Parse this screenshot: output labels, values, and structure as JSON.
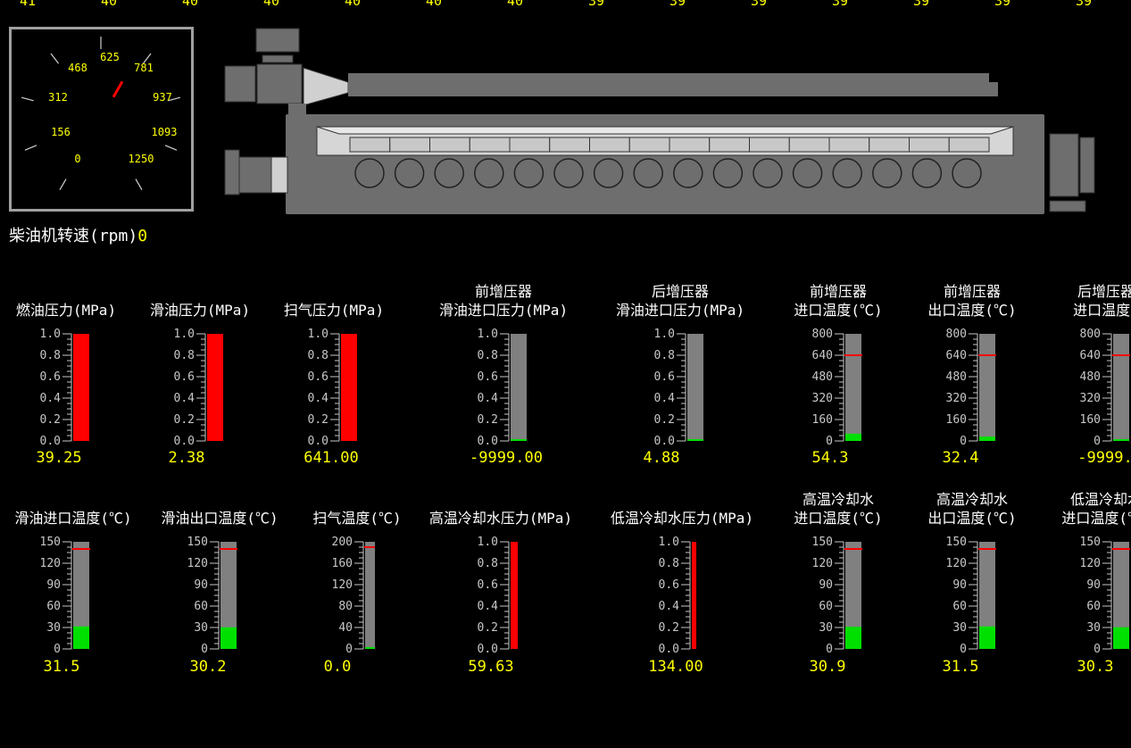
{
  "top_numbers": [
    "41",
    "40",
    "40",
    "40",
    "40",
    "40",
    "40",
    "39",
    "39",
    "39",
    "39",
    "39",
    "39",
    "39"
  ],
  "colors": {
    "background": "#000000",
    "text": "#ffff00",
    "bar_red": "#ff0000",
    "bar_green": "#00e000",
    "bar_bg": "#808080",
    "limit": "#ff0000"
  },
  "engine": {
    "rpm_label": "柴油机转速(rpm)",
    "rpm_value": "0",
    "dial_labels": [
      "0",
      "156",
      "312",
      "468",
      "625",
      "781",
      "937",
      "1093",
      "1250"
    ],
    "cylinders": 16
  },
  "gauges_row1": [
    {
      "title": [
        "燃油压力(MPa)"
      ],
      "ticks": [
        "1.0",
        "0.8",
        "0.6",
        "0.4",
        "0.2",
        "0.0"
      ],
      "max": 1.0,
      "fill": 1.0,
      "color": "red",
      "limit": null,
      "value": "39.25"
    },
    {
      "title": [
        "滑油压力(MPa)"
      ],
      "ticks": [
        "1.0",
        "0.8",
        "0.6",
        "0.4",
        "0.2",
        "0.0"
      ],
      "max": 1.0,
      "fill": 1.0,
      "color": "red",
      "limit": null,
      "value": "2.38"
    },
    {
      "title": [
        "扫气压力(MPa)"
      ],
      "ticks": [
        "1.0",
        "0.8",
        "0.6",
        "0.4",
        "0.2",
        "0.0"
      ],
      "max": 1.0,
      "fill": 1.0,
      "color": "red",
      "limit": null,
      "value": "641.00"
    },
    {
      "title": [
        "前增压器",
        "滑油进口压力(MPa)"
      ],
      "ticks": [
        "1.0",
        "0.8",
        "0.6",
        "0.4",
        "0.2",
        "0.0"
      ],
      "max": 1.0,
      "fill": 0.0,
      "color": "green",
      "limit": null,
      "value": "-9999.00"
    },
    {
      "title": [
        "后增压器",
        "滑油进口压力(MPa)"
      ],
      "ticks": [
        "1.0",
        "0.8",
        "0.6",
        "0.4",
        "0.2",
        "0.0"
      ],
      "max": 1.0,
      "fill": 0.0,
      "color": "green",
      "limit": null,
      "value": "4.88"
    },
    {
      "title": [
        "前增压器",
        "进口温度(℃)"
      ],
      "ticks": [
        "800",
        "640",
        "480",
        "320",
        "160",
        "0"
      ],
      "max": 800,
      "fill": 54.3,
      "color": "green",
      "limit": 640,
      "value": "54.3"
    },
    {
      "title": [
        "前增压器",
        "出口温度(℃)"
      ],
      "ticks": [
        "800",
        "640",
        "480",
        "320",
        "160",
        "0"
      ],
      "max": 800,
      "fill": 32.4,
      "color": "green",
      "limit": 640,
      "value": "32.4"
    },
    {
      "title": [
        "后增压器",
        "进口温度("
      ],
      "ticks": [
        "800",
        "640",
        "480",
        "320",
        "160",
        "0"
      ],
      "max": 800,
      "fill": 0,
      "color": "green",
      "limit": 640,
      "value": "-9999."
    }
  ],
  "gauges_row2": [
    {
      "title": [
        "滑油进口温度(℃)"
      ],
      "ticks": [
        "150",
        "120",
        "90",
        "60",
        "30",
        "0"
      ],
      "max": 150,
      "fill": 31.5,
      "color": "green",
      "limit": 140,
      "value": "31.5"
    },
    {
      "title": [
        "滑油出口温度(℃)"
      ],
      "ticks": [
        "150",
        "120",
        "90",
        "60",
        "30",
        "0"
      ],
      "max": 150,
      "fill": 30.2,
      "color": "green",
      "limit": 140,
      "value": "30.2"
    },
    {
      "title": [
        "扫气温度(℃)"
      ],
      "ticks": [
        "200",
        "160",
        "120",
        "80",
        "40",
        "0"
      ],
      "max": 200,
      "fill": 0.0,
      "color": "green",
      "limit": 190,
      "value": "0.0"
    },
    {
      "title": [
        "高温冷却水压力(MPa)"
      ],
      "ticks": [
        "1.0",
        "0.8",
        "0.6",
        "0.4",
        "0.2",
        "0.0"
      ],
      "max": 1.0,
      "fill": 1.0,
      "color": "red",
      "limit": null,
      "value": "59.63"
    },
    {
      "title": [
        "低温冷却水压力(MPa)"
      ],
      "ticks": [
        "1.0",
        "0.8",
        "0.6",
        "0.4",
        "0.2",
        "0.0"
      ],
      "max": 1.0,
      "fill": 1.0,
      "color": "red",
      "limit": null,
      "value": "134.00"
    },
    {
      "title": [
        "高温冷却水",
        "进口温度(℃)"
      ],
      "ticks": [
        "150",
        "120",
        "90",
        "60",
        "30",
        "0"
      ],
      "max": 150,
      "fill": 30.9,
      "color": "green",
      "limit": 140,
      "value": "30.9"
    },
    {
      "title": [
        "高温冷却水",
        "出口温度(℃)"
      ],
      "ticks": [
        "150",
        "120",
        "90",
        "60",
        "30",
        "0"
      ],
      "max": 150,
      "fill": 31.5,
      "color": "green",
      "limit": 140,
      "value": "31.5"
    },
    {
      "title": [
        "低温冷却水",
        "进口温度(℃)"
      ],
      "ticks": [
        "150",
        "120",
        "90",
        "60",
        "30",
        "0"
      ],
      "max": 150,
      "fill": 30.3,
      "color": "green",
      "limit": 140,
      "value": "30.3"
    }
  ]
}
